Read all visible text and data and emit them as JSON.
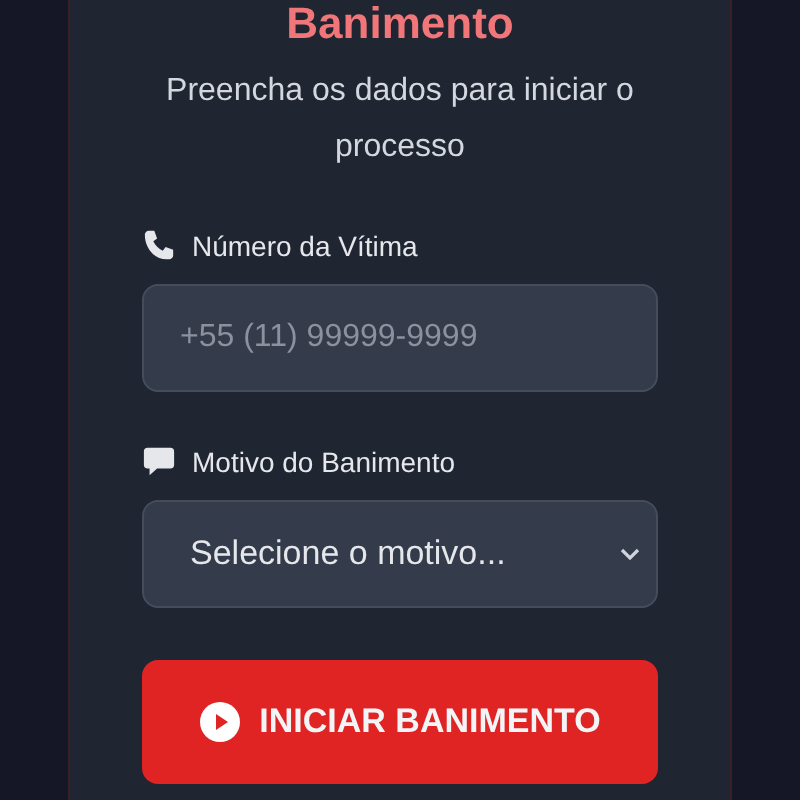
{
  "title": "Banimento",
  "subtitle": "Preencha os dados para iniciar o processo",
  "fields": [
    {
      "kind": "input",
      "label": "Número da Vítima",
      "placeholder": "+55 (11) 99999-9999"
    },
    {
      "kind": "select",
      "label": "Motivo do Banimento",
      "value": "Selecione o motivo..."
    }
  ],
  "button": {
    "label": "INICIAR BANIMENTO"
  }
}
